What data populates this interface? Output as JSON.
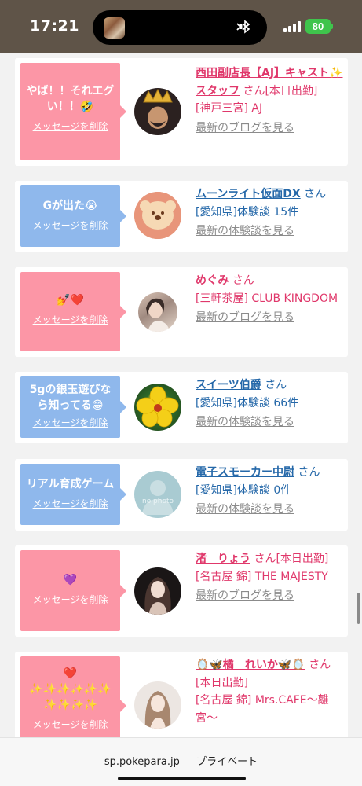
{
  "status": {
    "time": "17:21",
    "battery": "80"
  },
  "colors": {
    "status_bar": "#5f5448",
    "bubble_pink": "#fc96a6",
    "bubble_blue": "#8fb8ec",
    "name_pink": "#e0386b",
    "name_blue": "#2568a9",
    "link_gray": "#8b8b8b"
  },
  "messages": [
    {
      "bubble_text": "やば！！それエグい！！🤣",
      "delete_label": "メッセージを削除",
      "name": "西田副店長【AJ】キャスト✨スタッフ",
      "honorific": "さん",
      "tag": "[本日出勤]",
      "location": "[神戸三宮] AJ",
      "link": "最新のブログを見る",
      "avatar": "crown-man-avatar"
    },
    {
      "bubble_text": "Gが出た😭",
      "delete_label": "メッセージを削除",
      "name": "ムーンライト仮面DX",
      "honorific": "さん",
      "location": "[愛知県]体験談 15件",
      "link": "最新の体験談を見る",
      "avatar": "koala-cookie-avatar"
    },
    {
      "bubble_text": "💅❤️",
      "delete_label": "メッセージを削除",
      "name": "めぐみ",
      "honorific": "さん",
      "location": "[三軒茶屋] CLUB KINGDOM",
      "link": "最新のブログを見る",
      "avatar": "woman-photo-avatar"
    },
    {
      "bubble_text": "5gの銀玉遊びなら知ってる😁",
      "delete_label": "メッセージを削除",
      "name": "スイーツ伯爵",
      "honorific": "さん",
      "location": "[愛知県]体験談 66件",
      "link": "最新の体験談を見る",
      "avatar": "flower-avatar"
    },
    {
      "bubble_text": "リアル育成ゲーム",
      "delete_label": "メッセージを削除",
      "name": "電子スモーカー中尉",
      "honorific": "さん",
      "location": "[愛知県]体験談 0件",
      "link": "最新の体験談を見る",
      "avatar": "no-photo-avatar",
      "avatar_text": "no photo"
    },
    {
      "bubble_text": "💜",
      "delete_label": "メッセージを削除",
      "name": "渚　りょう",
      "honorific": "さん",
      "tag": "[本日出勤]",
      "location": "[名古屋 錦] THE MAJESTY",
      "link": "最新のブログを見る",
      "avatar": "woman-dark-avatar"
    },
    {
      "bubble_text": "❤️\n✨✨✨✨✨✨\n✨✨✨✨",
      "delete_label": "メッセージを削除",
      "name": "🪞🦋橘　れいか🦋🪞",
      "honorific": "さん",
      "tag": "[本日出勤]",
      "location": "[名古屋 錦] Mrs.CAFE〜離宮〜",
      "avatar": "woman-light-avatar"
    }
  ],
  "browser": {
    "domain": "sp.pokepara.jp",
    "separator": " — ",
    "mode": "プライベート"
  }
}
